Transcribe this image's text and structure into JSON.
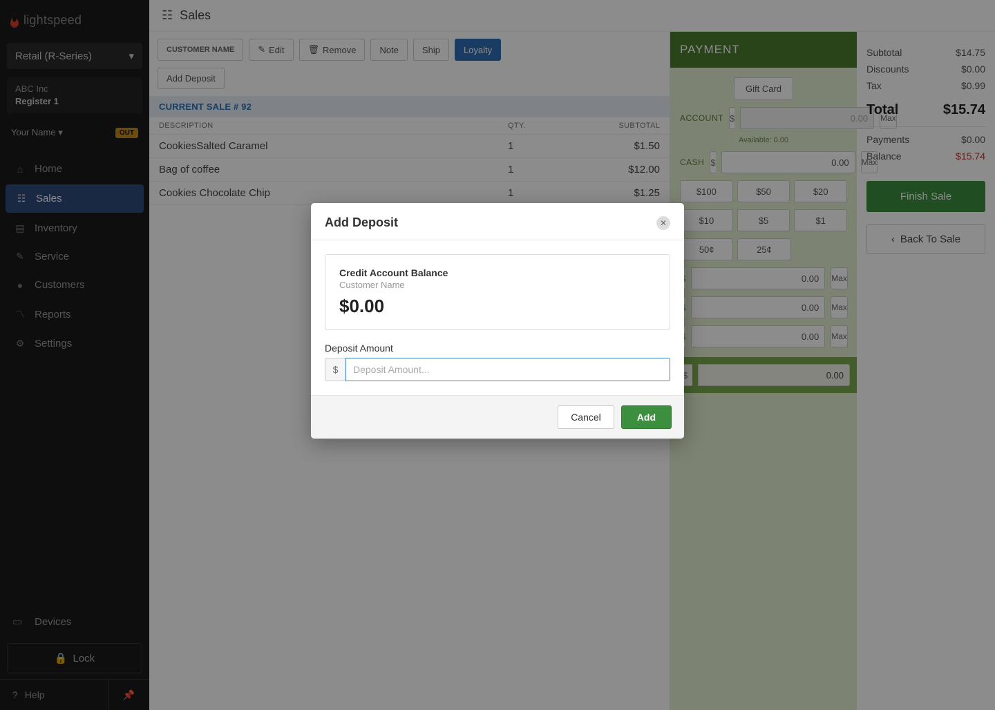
{
  "brand": "lightspeed",
  "selector": "Retail (R-Series)",
  "company": "ABC Inc",
  "register": "Register 1",
  "user": "Your Name",
  "out_badge": "OUT",
  "nav": {
    "home": "Home",
    "sales": "Sales",
    "inventory": "Inventory",
    "service": "Service",
    "customers": "Customers",
    "reports": "Reports",
    "settings": "Settings",
    "devices": "Devices",
    "lock": "Lock",
    "help": "Help"
  },
  "page_title": "Sales",
  "toolbar": {
    "customer": "CUSTOMER NAME",
    "edit": "Edit",
    "remove": "Remove",
    "note": "Note",
    "ship": "Ship",
    "loyalty": "Loyalty",
    "add_deposit": "Add Deposit"
  },
  "sale": {
    "header": "CURRENT SALE # 92",
    "cols": {
      "desc": "DESCRIPTION",
      "qty": "QTY.",
      "sub": "SUBTOTAL"
    },
    "rows": [
      {
        "desc": "CookiesSalted Caramel",
        "qty": "1",
        "sub": "$1.50"
      },
      {
        "desc": "Bag of coffee",
        "qty": "1",
        "sub": "$12.00"
      },
      {
        "desc": "Cookies Chocolate Chip",
        "qty": "1",
        "sub": "$1.25"
      }
    ]
  },
  "payment": {
    "heading": "PAYMENT",
    "gift_card": "Gift Card",
    "account_label": "ACCOUNT",
    "available": "Available: 0.00",
    "cash_label": "CASH",
    "max": "Max",
    "quick": [
      "$100",
      "$50",
      "$20",
      "$10",
      "$5",
      "$1",
      "50¢",
      "25¢"
    ],
    "zero": "0.00"
  },
  "summary": {
    "subtotal_label": "Subtotal",
    "subtotal": "$14.75",
    "discounts_label": "Discounts",
    "discounts": "$0.00",
    "tax_label": "Tax",
    "tax": "$0.99",
    "total_label": "Total",
    "total": "$15.74",
    "payments_label": "Payments",
    "payments": "$0.00",
    "balance_label": "Balance",
    "balance": "$15.74",
    "finish": "Finish Sale",
    "back": "Back To Sale"
  },
  "modal": {
    "title": "Add Deposit",
    "card_title": "Credit Account Balance",
    "card_sub": "Customer Name",
    "card_amount": "$0.00",
    "field_label": "Deposit Amount",
    "currency": "$",
    "placeholder": "Deposit Amount...",
    "cancel": "Cancel",
    "add": "Add"
  }
}
